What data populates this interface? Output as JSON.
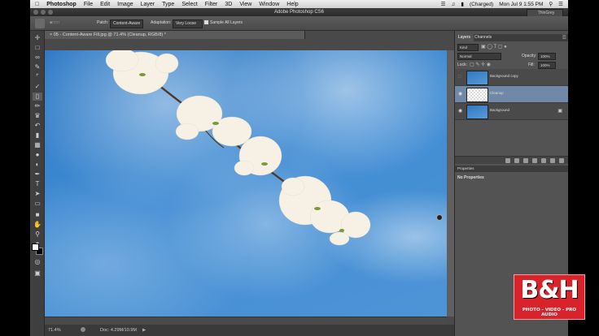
{
  "menubar": {
    "app": "Photoshop",
    "items": [
      "File",
      "Edit",
      "Image",
      "Layer",
      "Type",
      "Select",
      "Filter",
      "3D",
      "View",
      "Window",
      "Help"
    ],
    "status": "(Charged)",
    "clock": "Mon Jul 9  1:55 PM"
  },
  "titlebar": {
    "title": "Adobe Photoshop CS6",
    "workspace": "ThinGrey"
  },
  "options": {
    "patch_label": "Patch:",
    "patch_value": "Content-Aware",
    "adaptation_label": "Adaptation:",
    "adaptation_value": "Very Loose",
    "sample_all_label": "Sample All Layers"
  },
  "document": {
    "tab_title": "05 - Content-Aware Fill.jpg @ 71.4% (Cleanup, RGB/8) *",
    "zoom": "71.4%",
    "doc_size": "Doc: 4.29M/10.9M"
  },
  "layers_panel": {
    "tab_layers": "Layers",
    "tab_channels": "Channels",
    "kind_label": "Kind",
    "blend_mode": "Normal",
    "opacity_label": "Opacity:",
    "opacity_value": "100%",
    "lock_label": "Lock:",
    "fill_label": "Fill:",
    "fill_value": "100%",
    "layers": [
      {
        "name": "Background copy",
        "visible": false,
        "selected": false
      },
      {
        "name": "Cleanup",
        "visible": true,
        "selected": true
      },
      {
        "name": "Background",
        "visible": true,
        "selected": false
      }
    ]
  },
  "properties_panel": {
    "title": "Properties",
    "body": "No Properties"
  },
  "logo": {
    "big": "B&H",
    "small": "PHOTO - VIDEO - PRO AUDIO"
  },
  "colors": {
    "selected_layer": "#7089a8",
    "sky": "#3f8bd3",
    "logo_red": "#d8232a"
  }
}
